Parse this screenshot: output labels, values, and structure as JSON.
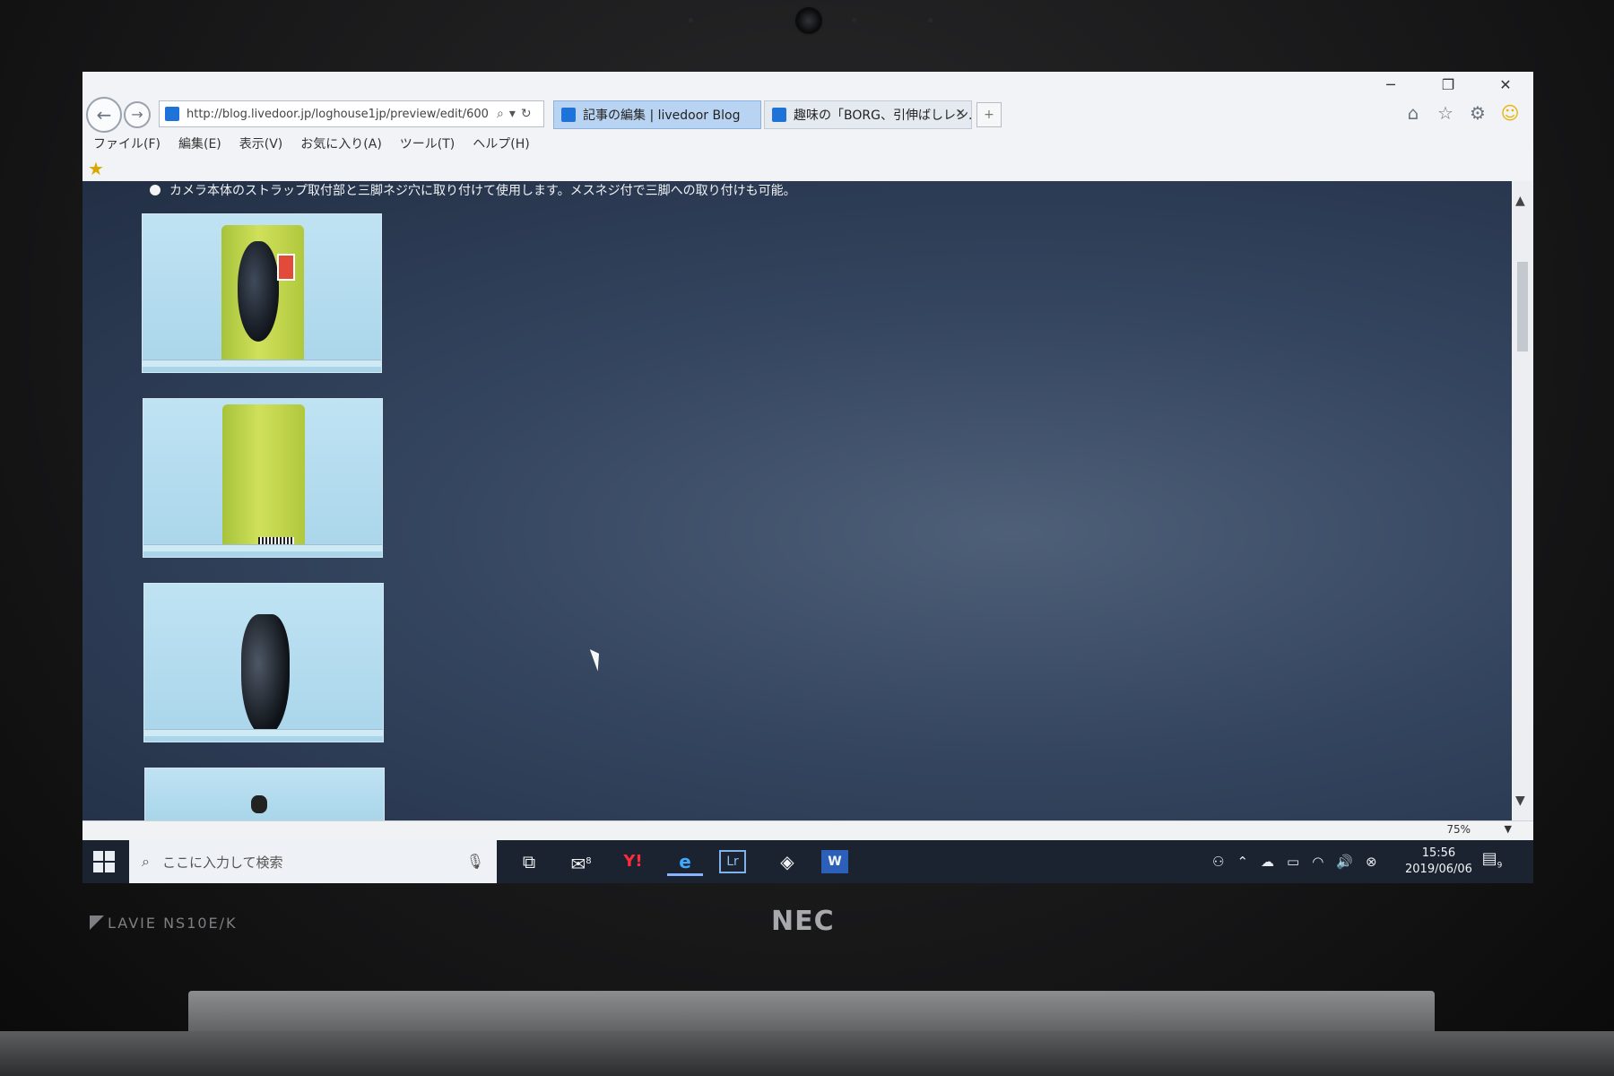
{
  "device": {
    "brand_left": "LAVIE  NS10E/K",
    "brand_center": "NEC"
  },
  "browser": {
    "url": "http://blog.livedoor.jp/loghouse1jp/preview/edit/600",
    "tabs": [
      {
        "label": "記事の編集 | livedoor Blog",
        "active": true
      },
      {
        "label": "趣味の「BORG、引伸ばしレン...",
        "active": false
      }
    ],
    "tab_close": "✕",
    "menu": [
      "ファイル(F)",
      "編集(E)",
      "表示(V)",
      "お気に入り(A)",
      "ツール(T)",
      "ヘルプ(H)"
    ],
    "zoom": "75%"
  },
  "page": {
    "bullet_text": "カメラ本体のストラップ取付部と三脚ネジ穴に取り付けて使用します。メスネジ付で三脚への取り付けも可能。",
    "thumbnails": [
      {
        "name": "package-front"
      },
      {
        "name": "package-back"
      },
      {
        "name": "strap-only"
      },
      {
        "name": "partial-item"
      }
    ]
  },
  "taskbar": {
    "search_placeholder": "ここに入力して検索",
    "mail_badge": "8",
    "notifications_badge": "9",
    "time": "15:56",
    "date": "2019/06/06"
  },
  "colors": {
    "page_bg": "#34455f",
    "tab_active": "#b9d4f2",
    "taskbar": "#1c2330"
  }
}
